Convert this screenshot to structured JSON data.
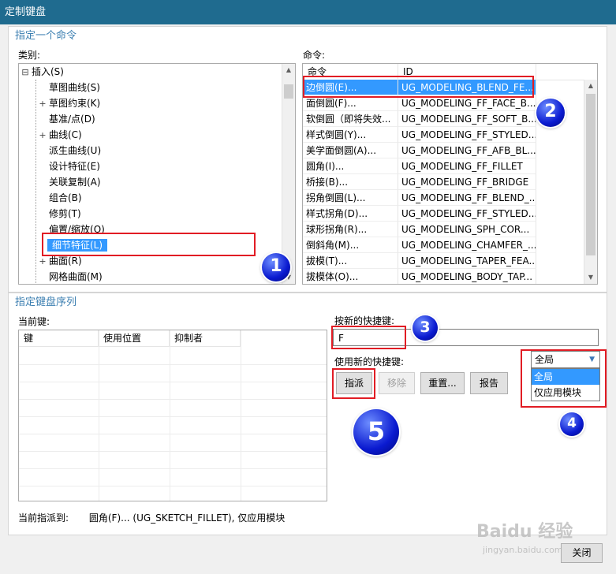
{
  "window": {
    "title": "定制键盘"
  },
  "command_section": {
    "title": "指定一个命令",
    "category_label": "类别:",
    "command_label": "命令:",
    "tree": [
      {
        "label": "插入(S)",
        "expander": "⊟",
        "level": 0,
        "selected": false
      },
      {
        "label": "草图曲线(S)",
        "expander": "",
        "level": 1,
        "selected": false
      },
      {
        "label": "草图约束(K)",
        "expander": "+",
        "level": 1,
        "selected": false
      },
      {
        "label": "基准/点(D)",
        "expander": "",
        "level": 1,
        "selected": false
      },
      {
        "label": "曲线(C)",
        "expander": "+",
        "level": 1,
        "selected": false
      },
      {
        "label": "派生曲线(U)",
        "expander": "",
        "level": 1,
        "selected": false
      },
      {
        "label": "设计特征(E)",
        "expander": "",
        "level": 1,
        "selected": false
      },
      {
        "label": "关联复制(A)",
        "expander": "",
        "level": 1,
        "selected": false
      },
      {
        "label": "组合(B)",
        "expander": "",
        "level": 1,
        "selected": false
      },
      {
        "label": "修剪(T)",
        "expander": "",
        "level": 1,
        "selected": false
      },
      {
        "label": "偏置/缩放(O)",
        "expander": "",
        "level": 1,
        "selected": false
      },
      {
        "label": "细节特征(L)",
        "expander": "",
        "level": 1,
        "selected": true
      },
      {
        "label": "曲面(R)",
        "expander": "+",
        "level": 1,
        "selected": false
      },
      {
        "label": "网格曲面(M)",
        "expander": "",
        "level": 1,
        "selected": false
      }
    ],
    "command_columns": [
      "命令",
      "ID"
    ],
    "commands": [
      {
        "name": "边倒圆(E)...",
        "id": "UG_MODELING_BLEND_FE...",
        "selected": true
      },
      {
        "name": "面倒圆(F)...",
        "id": "UG_MODELING_FF_FACE_B...",
        "selected": false
      },
      {
        "name": "软倒圆（即将失效...",
        "id": "UG_MODELING_FF_SOFT_B...",
        "selected": false
      },
      {
        "name": "样式倒圆(Y)...",
        "id": "UG_MODELING_FF_STYLED...",
        "selected": false
      },
      {
        "name": "美学面倒圆(A)...",
        "id": "UG_MODELING_FF_AFB_BL...",
        "selected": false
      },
      {
        "name": "圆角(I)...",
        "id": "UG_MODELING_FF_FILLET",
        "selected": false
      },
      {
        "name": "桥接(B)...",
        "id": "UG_MODELING_FF_BRIDGE",
        "selected": false
      },
      {
        "name": "拐角倒圆(L)...",
        "id": "UG_MODELING_FF_BLEND_...",
        "selected": false
      },
      {
        "name": "样式拐角(D)...",
        "id": "UG_MODELING_FF_STYLED...",
        "selected": false
      },
      {
        "name": "球形拐角(R)...",
        "id": "UG_MODELING_SPH_COR...",
        "selected": false
      },
      {
        "name": "倒斜角(M)...",
        "id": "UG_MODELING_CHAMFER_...",
        "selected": false
      },
      {
        "name": "拔模(T)...",
        "id": "UG_MODELING_TAPER_FEA...",
        "selected": false
      },
      {
        "name": "拔模体(O)...",
        "id": "UG_MODELING_BODY_TAP...",
        "selected": false
      }
    ]
  },
  "key_section": {
    "title": "指定键盘序列",
    "current_keys_label": "当前键:",
    "key_columns": [
      "键",
      "使用位置",
      "抑制者"
    ],
    "press_new_label": "按新的快捷键:",
    "new_key_value": "F",
    "use_new_label": "使用新的快捷键:",
    "buttons": {
      "assign": "指派",
      "remove": "移除",
      "reset": "重置...",
      "report": "报告"
    },
    "scope_selected": "全局",
    "scope_options": [
      "全局",
      "仅应用模块"
    ],
    "status_label": "当前指派到:",
    "status_value": "圆角(F)... (UG_SKETCH_FILLET), 仅应用模块"
  },
  "close_label": "关闭",
  "annotations": [
    "1",
    "2",
    "3",
    "4",
    "5"
  ],
  "watermark": {
    "brand": "Baidu 经验",
    "url": "jingyan.baidu.com"
  },
  "colors": {
    "title_bar": "#1f6b8f",
    "selection": "#3399ff",
    "section_title": "#3c7fb1",
    "highlight_box": "#e11c24",
    "badge": "#0a1ad0"
  }
}
